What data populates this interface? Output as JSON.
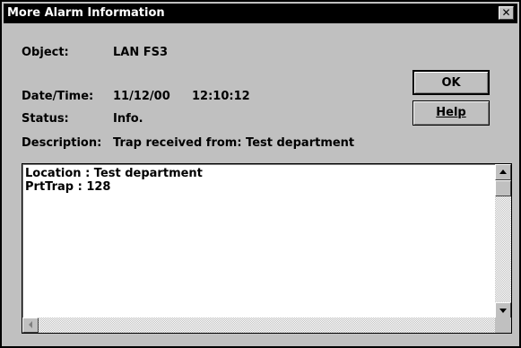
{
  "window": {
    "title": "More Alarm Information",
    "close_glyph": "✕"
  },
  "fields": {
    "object_label": "Object:",
    "object_value": "LAN FS3",
    "datetime_label": "Date/Time:",
    "date_value": "11/12/00",
    "time_value": "12:10:12",
    "status_label": "Status:",
    "status_value": "Info.",
    "description_label": "Description:",
    "description_value": "Trap received from: Test department"
  },
  "buttons": {
    "ok_label": "OK",
    "help_label": "Help"
  },
  "details": {
    "text": "Location : Test department\nPrtTrap : 128"
  },
  "icons": {
    "close": "close-icon",
    "scroll_up": "arrow-up-icon",
    "scroll_down": "arrow-down-icon",
    "scroll_left": "arrow-left-icon"
  },
  "colors": {
    "titlebar": "#000000",
    "face": "#c0c0c0",
    "text_bg": "#ffffff"
  }
}
